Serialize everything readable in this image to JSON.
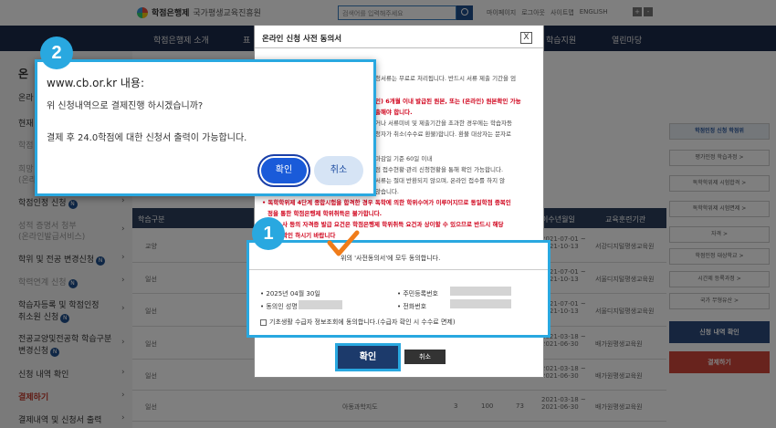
{
  "header": {
    "logo_main": "학점은행제",
    "logo_sub": "국가평생교육진흥원",
    "search_placeholder": "검색어를 입력해주세요",
    "links": [
      "마이페이지",
      "로그아웃",
      "사이트맵",
      "ENGLISH"
    ],
    "font_buttons": [
      "+",
      "-"
    ]
  },
  "nav": [
    "학점은행제 소개",
    "표",
    "학습지원",
    "열린마당"
  ],
  "left_menu": {
    "title": "온",
    "items": [
      {
        "label": "온라",
        "style": "normal"
      },
      {
        "label": "현재",
        "style": "normal"
      },
      {
        "label": "학점",
        "style": "dim"
      },
      {
        "label": "희망",
        "style": "dim"
      },
      {
        "label": "(온라",
        "style": "dim"
      },
      {
        "label": "학점인정 신청",
        "style": "normal",
        "badge": "N"
      },
      {
        "label": "성적 증명서 청부",
        "style": "dim"
      },
      {
        "label": "(온라인발급서비스)",
        "style": "dim"
      },
      {
        "label": "학위 및 전공 변경신청",
        "style": "normal",
        "badge": "N"
      },
      {
        "label": "학력연계 신청",
        "style": "dim",
        "badge": "N"
      },
      {
        "label": "학습자등록 및 학점인정",
        "style": "normal"
      },
      {
        "label": "취소원 신청",
        "style": "normal",
        "badge": "N"
      },
      {
        "label": "전공교양및전공학 학습구분",
        "style": "normal"
      },
      {
        "label": "변경신청",
        "style": "normal",
        "badge": "N"
      },
      {
        "label": "신청 내역 확인",
        "style": "normal"
      },
      {
        "label": "결제하기",
        "style": "red"
      },
      {
        "label": "결제내역 및 신청서 출력",
        "style": "normal"
      }
    ]
  },
  "table": {
    "headers": [
      "학습구분",
      "이수년월일",
      "교육훈련기관"
    ],
    "rows": [
      {
        "type": "교양",
        "date": "2021-07-01 ~\n2021-10-13",
        "org": "서강디지털평생교육원"
      },
      {
        "type": "일선",
        "date": "2021-07-01 ~\n2021-10-13",
        "org": "서울디지털평생교육원"
      },
      {
        "type": "일선",
        "date": "2021-07-01 ~\n2021-10-13",
        "org": "서울디지털평생교육원"
      },
      {
        "type": "일선",
        "date": "2021-03-18 ~\n2021-06-30",
        "org": "배가원평생교육원"
      },
      {
        "type": "일선",
        "date": "2021-03-18 ~\n2021-06-30",
        "org": "배가원평생교육원"
      },
      {
        "type": "일선",
        "subject": "아동과학지도",
        "c1": "3",
        "c2": "100",
        "c3": "73",
        "date": "2021-03-18 ~\n2021-06-30",
        "org": "배가원평생교육원"
      }
    ]
  },
  "right_sidebar": {
    "head": "학점인정 신청 학점위",
    "boxes": [
      "평가인정 학습과정 >",
      "독학학위제 시험합격 >",
      "독학학위제 시험면제 >",
      "자격 >",
      "학점인정 대상학교 >",
      "시간제 등록과정 >",
      "국가 무형유산 >"
    ],
    "btn_history": "신청 내역 확인",
    "btn_pay": "결제하기",
    "colors": {
      "history": "#2c4a7c",
      "pay": "#d0463b"
    }
  },
  "consent_modal": {
    "title": "온라인 신청 사전 동의서",
    "close": "X",
    "lines": [
      {
        "text": "청서류는 무료로 처리됩니다. 반드시 서류 제출 기간을 엄",
        "style": "normal"
      },
      {
        "text": "인) 6개월 이내 발급된 원본, 또는 (온라인) 원본확인 가능",
        "style": "red"
      },
      {
        "text": "출해야 합니다.",
        "style": "red"
      },
      {
        "text": "거나 서류미비 및 제출기간을 초과한 경우에는 학습자등",
        "style": "normal"
      },
      {
        "text": "청자가 취소(수수료 환불)합니다. 환불 대상자는 문자로",
        "style": "normal"
      },
      {
        "text": "마감일 기준 60일 이내",
        "style": "normal"
      },
      {
        "text": "점 접수현황·관리 신청현황을 통해 확인 가능합니다.",
        "style": "normal"
      },
      {
        "text": "서류는 절대 반환되지 않으며, 온라인 접수를 하지 않",
        "style": "normal"
      },
      {
        "text": "않습니다.",
        "style": "normal"
      },
      {
        "text": "• 독학학위제 4단계 종합시험을 합격한 경우 독학에 의한 학위수여가 이루어지므로 동일학점 중복인",
        "style": "mixed"
      },
      {
        "text": "정을 통한 학점은행제 학위취득은 불가합니다.",
        "style": "mixed"
      },
      {
        "text": "사 등의 자격증 발급 요건은 학점은행제 학위취득 요건과 상이할 수 있으므로 반드시 해당",
        "style": "mixed"
      },
      {
        "text": "확인 하시기 바랍니다",
        "style": "mixed"
      }
    ],
    "agree_label": "위의 '사전동의서'에 모두 동의합니다.",
    "date_label": "2025년 04월 30일",
    "applicant_label": "동의인 성명",
    "ssn_label": "주민등록번호",
    "phone_label": "전화번호",
    "basic_consent": "기초생활 수급자 정보조회에 동의합니다.(수급자 확인 시 수수료 면제)",
    "confirm": "확인",
    "cancel": "취소"
  },
  "callouts": [
    "1",
    "2"
  ],
  "alert": {
    "origin": "www.cb.or.kr 내용:",
    "question": "위 신청내역으로 결제진행 하시겠습니까?",
    "message": "결제 후 24.0학점에 대한 신청서 출력이 가능합니다.",
    "ok": "확인",
    "cancel": "취소"
  },
  "colors": {
    "accent": "#29a8e0",
    "navy": "#1b2a4a",
    "check_orange": "#f07c1a",
    "alert_ok": "#1a5bd9"
  }
}
